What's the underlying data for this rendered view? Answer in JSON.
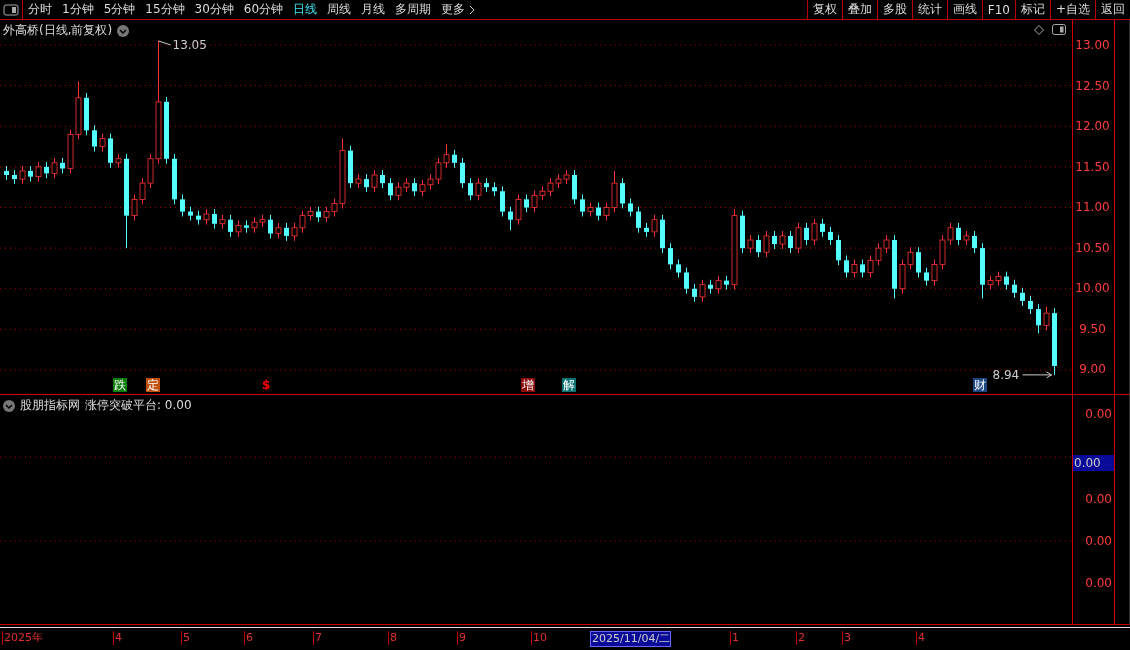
{
  "toolbar": {
    "periods": [
      {
        "label": "分时",
        "selected": false
      },
      {
        "label": "1分钟",
        "selected": false
      },
      {
        "label": "5分钟",
        "selected": false
      },
      {
        "label": "15分钟",
        "selected": false
      },
      {
        "label": "30分钟",
        "selected": false
      },
      {
        "label": "60分钟",
        "selected": false
      },
      {
        "label": "日线",
        "selected": true
      },
      {
        "label": "周线",
        "selected": false
      },
      {
        "label": "月线",
        "selected": false
      },
      {
        "label": "多周期",
        "selected": false
      }
    ],
    "more": "更多",
    "buttons": [
      "复权",
      "叠加",
      "多股",
      "统计",
      "画线",
      "F10",
      "标记",
      "+自选",
      "返回"
    ]
  },
  "chart": {
    "title": "外高桥(日线,前复权)",
    "high_label": "13.05",
    "low_label": "8.94",
    "chart_data": {
      "type": "candlestick",
      "grid": true,
      "ylim": [
        9,
        13
      ],
      "yticks": [
        {
          "value": 13,
          "label": "13.00"
        },
        {
          "value": 12.5,
          "label": "12.50"
        },
        {
          "value": 12,
          "label": "12.00"
        },
        {
          "value": 11.5,
          "label": "11.50"
        },
        {
          "value": 11,
          "label": "11.00"
        },
        {
          "value": 10.5,
          "label": "10.50"
        },
        {
          "value": 10,
          "label": "10.00"
        },
        {
          "value": 9.5,
          "label": "9.50"
        },
        {
          "value": 9,
          "label": "9.00"
        }
      ],
      "ohlc": [
        [
          11.45,
          11.51,
          11.34,
          11.4
        ],
        [
          11.4,
          11.46,
          11.29,
          11.35
        ],
        [
          11.35,
          11.51,
          11.29,
          11.45
        ],
        [
          11.45,
          11.51,
          11.32,
          11.38
        ],
        [
          11.38,
          11.56,
          11.32,
          11.5
        ],
        [
          11.5,
          11.56,
          11.36,
          11.42
        ],
        [
          11.42,
          11.61,
          11.36,
          11.55
        ],
        [
          11.55,
          11.61,
          11.42,
          11.48
        ],
        [
          11.48,
          11.96,
          11.42,
          11.9
        ],
        [
          11.9,
          12.55,
          11.84,
          12.35
        ],
        [
          12.35,
          12.41,
          11.89,
          11.95
        ],
        [
          11.95,
          12.01,
          11.69,
          11.75
        ],
        [
          11.75,
          11.91,
          11.69,
          11.85
        ],
        [
          11.85,
          11.91,
          11.49,
          11.55
        ],
        [
          11.55,
          11.66,
          11.49,
          11.6
        ],
        [
          11.6,
          11.66,
          10.5,
          10.9
        ],
        [
          10.9,
          11.16,
          10.84,
          11.1
        ],
        [
          11.1,
          11.36,
          11.04,
          11.3
        ],
        [
          11.3,
          11.66,
          11.24,
          11.6
        ],
        [
          11.6,
          13.05,
          11.54,
          12.3
        ],
        [
          12.3,
          12.36,
          11.54,
          11.6
        ],
        [
          11.6,
          11.66,
          11.04,
          11.1
        ],
        [
          11.1,
          11.16,
          10.89,
          10.95
        ],
        [
          10.95,
          11.01,
          10.84,
          10.9
        ],
        [
          10.9,
          10.96,
          10.79,
          10.85
        ],
        [
          10.85,
          10.98,
          10.79,
          10.92
        ],
        [
          10.92,
          10.98,
          10.74,
          10.8
        ],
        [
          10.8,
          10.91,
          10.74,
          10.85
        ],
        [
          10.85,
          10.91,
          10.64,
          10.7
        ],
        [
          10.7,
          10.84,
          10.64,
          10.78
        ],
        [
          10.78,
          10.84,
          10.69,
          10.75
        ],
        [
          10.75,
          10.88,
          10.69,
          10.82
        ],
        [
          10.82,
          10.91,
          10.76,
          10.85
        ],
        [
          10.85,
          10.91,
          10.62,
          10.68
        ],
        [
          10.68,
          10.81,
          10.62,
          10.75
        ],
        [
          10.75,
          10.81,
          10.59,
          10.65
        ],
        [
          10.65,
          10.81,
          10.59,
          10.75
        ],
        [
          10.75,
          10.96,
          10.69,
          10.9
        ],
        [
          10.9,
          11.01,
          10.84,
          10.95
        ],
        [
          10.95,
          11.01,
          10.82,
          10.88
        ],
        [
          10.88,
          11.01,
          10.82,
          10.95
        ],
        [
          10.95,
          11.11,
          10.89,
          11.05
        ],
        [
          11.05,
          11.85,
          10.99,
          11.7
        ],
        [
          11.7,
          11.76,
          11.24,
          11.3
        ],
        [
          11.3,
          11.41,
          11.24,
          11.35
        ],
        [
          11.35,
          11.41,
          11.19,
          11.25
        ],
        [
          11.25,
          11.46,
          11.19,
          11.4
        ],
        [
          11.4,
          11.46,
          11.24,
          11.3
        ],
        [
          11.3,
          11.36,
          11.09,
          11.15
        ],
        [
          11.15,
          11.31,
          11.09,
          11.25
        ],
        [
          11.25,
          11.36,
          11.19,
          11.3
        ],
        [
          11.3,
          11.36,
          11.14,
          11.2
        ],
        [
          11.2,
          11.34,
          11.14,
          11.28
        ],
        [
          11.28,
          11.41,
          11.22,
          11.35
        ],
        [
          11.35,
          11.61,
          11.29,
          11.55
        ],
        [
          11.55,
          11.78,
          11.49,
          11.65
        ],
        [
          11.65,
          11.71,
          11.49,
          11.55
        ],
        [
          11.55,
          11.61,
          11.24,
          11.3
        ],
        [
          11.3,
          11.36,
          11.09,
          11.15
        ],
        [
          11.15,
          11.36,
          11.09,
          11.3
        ],
        [
          11.3,
          11.36,
          11.19,
          11.25
        ],
        [
          11.25,
          11.31,
          11.14,
          11.2
        ],
        [
          11.2,
          11.26,
          10.89,
          10.95
        ],
        [
          10.95,
          11.01,
          10.72,
          10.85
        ],
        [
          10.85,
          11.16,
          10.79,
          11.1
        ],
        [
          11.1,
          11.16,
          10.94,
          11.0
        ],
        [
          11.0,
          11.21,
          10.94,
          11.15
        ],
        [
          11.15,
          11.26,
          11.09,
          11.2
        ],
        [
          11.2,
          11.36,
          11.14,
          11.3
        ],
        [
          11.3,
          11.41,
          11.24,
          11.35
        ],
        [
          11.35,
          11.46,
          11.29,
          11.4
        ],
        [
          11.4,
          11.46,
          11.04,
          11.1
        ],
        [
          11.1,
          11.16,
          10.89,
          10.95
        ],
        [
          10.95,
          11.06,
          10.89,
          11.0
        ],
        [
          11.0,
          11.06,
          10.84,
          10.9
        ],
        [
          10.9,
          11.06,
          10.84,
          11.0
        ],
        [
          11.0,
          11.45,
          10.94,
          11.3
        ],
        [
          11.3,
          11.36,
          10.99,
          11.05
        ],
        [
          11.05,
          11.11,
          10.89,
          10.95
        ],
        [
          10.95,
          11.01,
          10.69,
          10.75
        ],
        [
          10.75,
          10.81,
          10.64,
          10.7
        ],
        [
          10.7,
          10.91,
          10.64,
          10.85
        ],
        [
          10.85,
          10.91,
          10.44,
          10.5
        ],
        [
          10.5,
          10.56,
          10.24,
          10.3
        ],
        [
          10.3,
          10.36,
          10.14,
          10.2
        ],
        [
          10.2,
          10.26,
          9.94,
          10.0
        ],
        [
          10.0,
          10.06,
          9.84,
          9.9
        ],
        [
          9.9,
          10.11,
          9.84,
          10.05
        ],
        [
          10.05,
          10.11,
          9.94,
          10.0
        ],
        [
          10.0,
          10.16,
          9.94,
          10.1
        ],
        [
          10.1,
          10.16,
          9.99,
          10.05
        ],
        [
          10.05,
          10.98,
          9.99,
          10.9
        ],
        [
          10.9,
          10.96,
          10.44,
          10.5
        ],
        [
          10.5,
          10.66,
          10.44,
          10.6
        ],
        [
          10.6,
          10.66,
          10.39,
          10.45
        ],
        [
          10.45,
          10.71,
          10.39,
          10.65
        ],
        [
          10.65,
          10.71,
          10.49,
          10.55
        ],
        [
          10.55,
          10.71,
          10.49,
          10.65
        ],
        [
          10.65,
          10.71,
          10.44,
          10.5
        ],
        [
          10.5,
          10.81,
          10.44,
          10.75
        ],
        [
          10.75,
          10.81,
          10.54,
          10.6
        ],
        [
          10.6,
          10.86,
          10.54,
          10.8
        ],
        [
          10.8,
          10.86,
          10.64,
          10.7
        ],
        [
          10.7,
          10.76,
          10.54,
          10.6
        ],
        [
          10.6,
          10.66,
          10.29,
          10.35
        ],
        [
          10.35,
          10.41,
          10.14,
          10.2
        ],
        [
          10.2,
          10.36,
          10.14,
          10.3
        ],
        [
          10.3,
          10.36,
          10.14,
          10.2
        ],
        [
          10.2,
          10.41,
          10.14,
          10.35
        ],
        [
          10.35,
          10.56,
          10.29,
          10.5
        ],
        [
          10.5,
          10.66,
          10.44,
          10.6
        ],
        [
          10.6,
          10.66,
          9.88,
          10.0
        ],
        [
          10.0,
          10.36,
          9.94,
          10.3
        ],
        [
          10.3,
          10.51,
          10.24,
          10.45
        ],
        [
          10.45,
          10.51,
          10.14,
          10.2
        ],
        [
          10.2,
          10.26,
          10.04,
          10.1
        ],
        [
          10.1,
          10.36,
          10.04,
          10.3
        ],
        [
          10.3,
          10.66,
          10.24,
          10.6
        ],
        [
          10.6,
          10.81,
          10.54,
          10.75
        ],
        [
          10.75,
          10.81,
          10.54,
          10.6
        ],
        [
          10.6,
          10.71,
          10.54,
          10.65
        ],
        [
          10.65,
          10.71,
          10.44,
          10.5
        ],
        [
          10.5,
          10.56,
          9.88,
          10.05
        ],
        [
          10.05,
          10.16,
          9.99,
          10.1
        ],
        [
          10.1,
          10.21,
          10.04,
          10.15
        ],
        [
          10.15,
          10.21,
          9.99,
          10.05
        ],
        [
          10.05,
          10.11,
          9.89,
          9.95
        ],
        [
          9.95,
          10.01,
          9.79,
          9.85
        ],
        [
          9.85,
          9.91,
          9.69,
          9.75
        ],
        [
          9.75,
          9.81,
          9.45,
          9.55
        ],
        [
          9.55,
          9.78,
          9.49,
          9.7
        ],
        [
          9.7,
          9.76,
          8.94,
          9.05
        ]
      ]
    },
    "events": [
      {
        "label": "跌",
        "kind": "badge",
        "color": "#0a7d0a"
      },
      {
        "label": "定",
        "kind": "badge",
        "color": "#c0500c"
      },
      {
        "label": "$",
        "kind": "glyph",
        "color": "#ff0000"
      },
      {
        "label": "增",
        "kind": "badge",
        "color": "#8b0a0a"
      },
      {
        "label": "解",
        "kind": "badge",
        "color": "#0b7070"
      },
      {
        "label": "财",
        "kind": "badge",
        "color": "#1b4680"
      }
    ]
  },
  "indicator": {
    "name": "股朋指标网",
    "reading": "涨停突破平台: 0.00",
    "ticks": [
      "0.00",
      "0.00",
      "0.00",
      "0.00"
    ],
    "cursor_value": "0.00"
  },
  "time_axis": {
    "labels": [
      "2025年",
      "4",
      "5",
      "6",
      "7",
      "8",
      "9",
      "10",
      "1",
      "2",
      "3",
      "4"
    ],
    "cursor_date": "2025/11/04/二"
  }
}
